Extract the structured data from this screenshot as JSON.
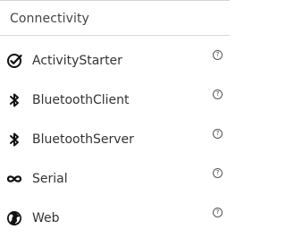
{
  "category": {
    "title": "Connectivity"
  },
  "items": [
    {
      "label": "ActivityStarter",
      "icon": "check-circle-icon",
      "help": "?"
    },
    {
      "label": "BluetoothClient",
      "icon": "bluetooth-icon",
      "help": "?"
    },
    {
      "label": "BluetoothServer",
      "icon": "bluetooth-icon",
      "help": "?"
    },
    {
      "label": "Serial",
      "icon": "infinity-icon",
      "help": "?"
    },
    {
      "label": "Web",
      "icon": "globe-icon",
      "help": "?"
    }
  ],
  "colors": {
    "text": "#333333",
    "icon": "#111111",
    "divider": "#d9d9d9"
  }
}
